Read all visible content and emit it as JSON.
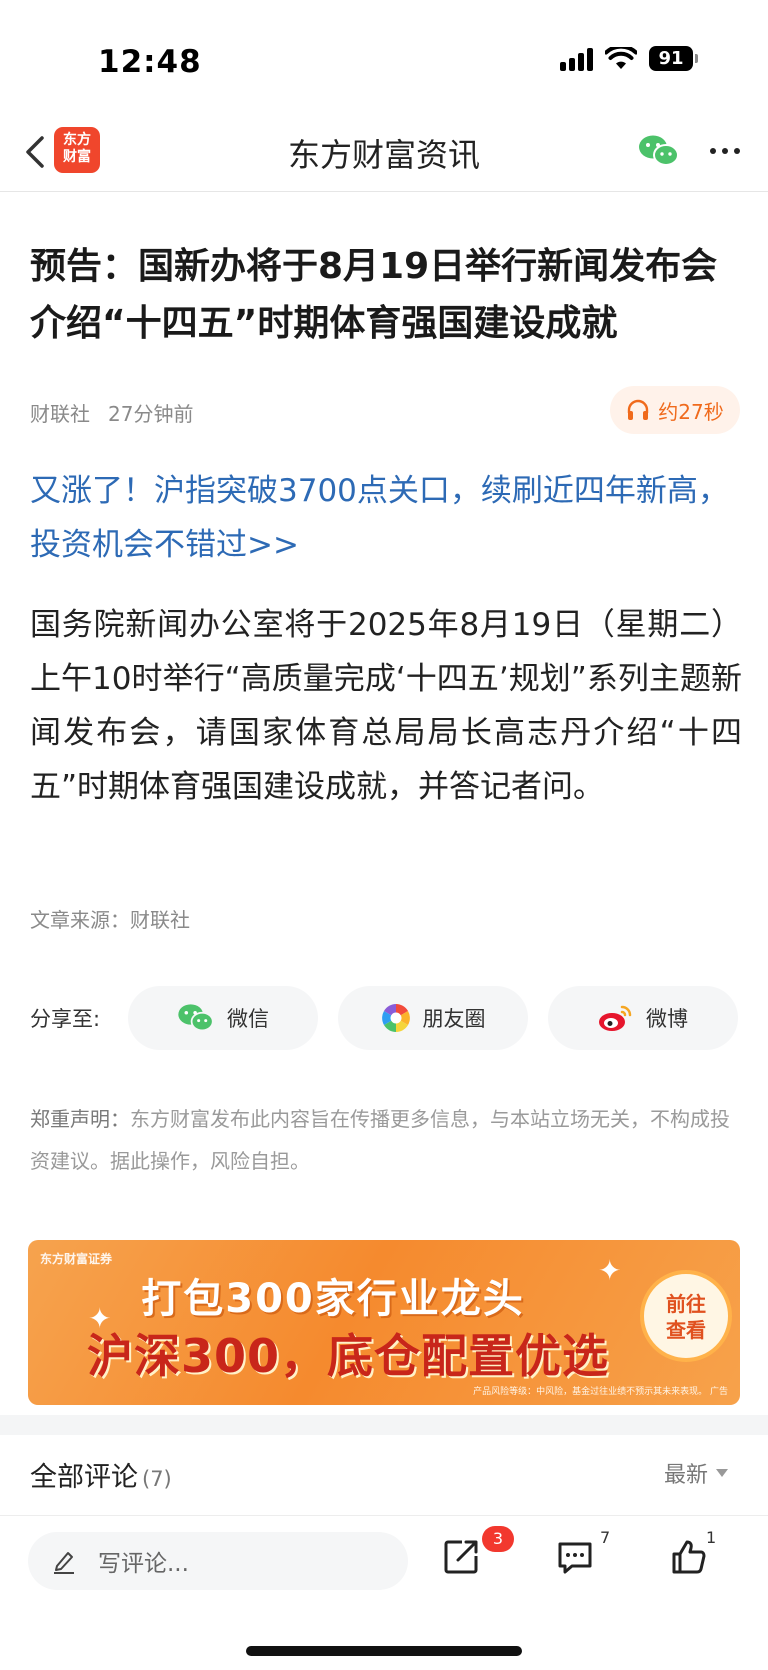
{
  "status_bar": {
    "time": "12:48",
    "battery": "91"
  },
  "nav": {
    "title": "东方财富资讯",
    "logo_text": "东方财富"
  },
  "article": {
    "title": "预告：国新办将于8月19日举行新闻发布会 介绍“十四五”时期体育强国建设成就",
    "source_name": "财联社",
    "time_ago": "27分钟前",
    "audio_duration": "约27秒",
    "promo_link": "又涨了！沪指突破3700点关口，续刷近四年新高，投资机会不错过>>",
    "body": "国务院新闻办公室将于2025年8月19日（星期二）上午10时举行“高质量完成‘十四五’规划”系列主题新闻发布会，请国家体育总局局长高志丹介绍“十四五”时期体育强国建设成就，并答记者问。",
    "source_line": "文章来源：财联社"
  },
  "share": {
    "label": "分享至:",
    "wechat": "微信",
    "moments": "朋友圈",
    "weibo": "微博"
  },
  "disclaimer": {
    "label": "郑重声明：",
    "text": "东方财富发布此内容旨在传播更多信息，与本站立场无关，不构成投资建议。据此操作，风险自担。"
  },
  "banner": {
    "brand": "东方财富证券",
    "line1": "打包300家行业龙头",
    "line2": "沪深300，底仓配置优选",
    "cta_line1": "前往",
    "cta_line2": "查看",
    "risk_note": "产品风险等级：中风险，基金过往业绩不预示其未来表现。 广告"
  },
  "comments": {
    "heading": "全部评论",
    "count": "(7)",
    "sort": "最新"
  },
  "bottom_bar": {
    "placeholder": "写评论...",
    "share_badge": "3",
    "comment_count": "7",
    "like_count": "1"
  },
  "colors": {
    "accent_orange": "#f06a1c",
    "link_blue": "#2d6ab5",
    "brand_red": "#f0462c",
    "badge_red": "#f2382e"
  }
}
